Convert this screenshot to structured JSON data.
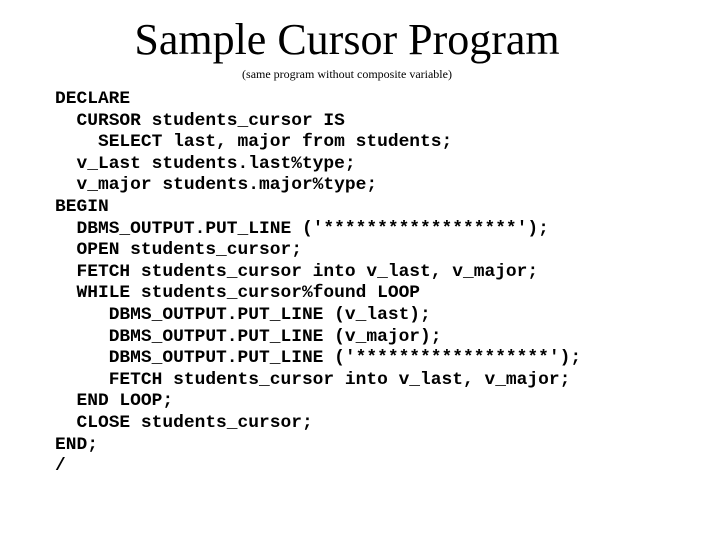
{
  "slide": {
    "title": "Sample Cursor Program",
    "subtitle": "(same program without composite variable)",
    "code_lines": [
      {
        "indent": 0,
        "text": "DECLARE"
      },
      {
        "indent": 2,
        "text": "CURSOR students_cursor IS"
      },
      {
        "indent": 4,
        "text": "SELECT last, major from students;"
      },
      {
        "indent": 2,
        "text": "v_Last students.last%type;"
      },
      {
        "indent": 2,
        "text": "v_major students.major%type;"
      },
      {
        "indent": 0,
        "text": "BEGIN"
      },
      {
        "indent": 2,
        "text": "DBMS_OUTPUT.PUT_LINE ('******************');"
      },
      {
        "indent": 2,
        "text": "OPEN students_cursor;"
      },
      {
        "indent": 2,
        "text": "FETCH students_cursor into v_last, v_major;"
      },
      {
        "indent": 2,
        "text": "WHILE students_cursor%found LOOP"
      },
      {
        "indent": 5,
        "text": "DBMS_OUTPUT.PUT_LINE (v_last);"
      },
      {
        "indent": 5,
        "text": "DBMS_OUTPUT.PUT_LINE (v_major);"
      },
      {
        "indent": 5,
        "text": "DBMS_OUTPUT.PUT_LINE ('******************');"
      },
      {
        "indent": 5,
        "text": "FETCH students_cursor into v_last, v_major;"
      },
      {
        "indent": 2,
        "text": "END LOOP;"
      },
      {
        "indent": 2,
        "text": "CLOSE students_cursor;"
      },
      {
        "indent": 0,
        "text": "END;"
      },
      {
        "indent": 0,
        "text": "/"
      }
    ]
  }
}
